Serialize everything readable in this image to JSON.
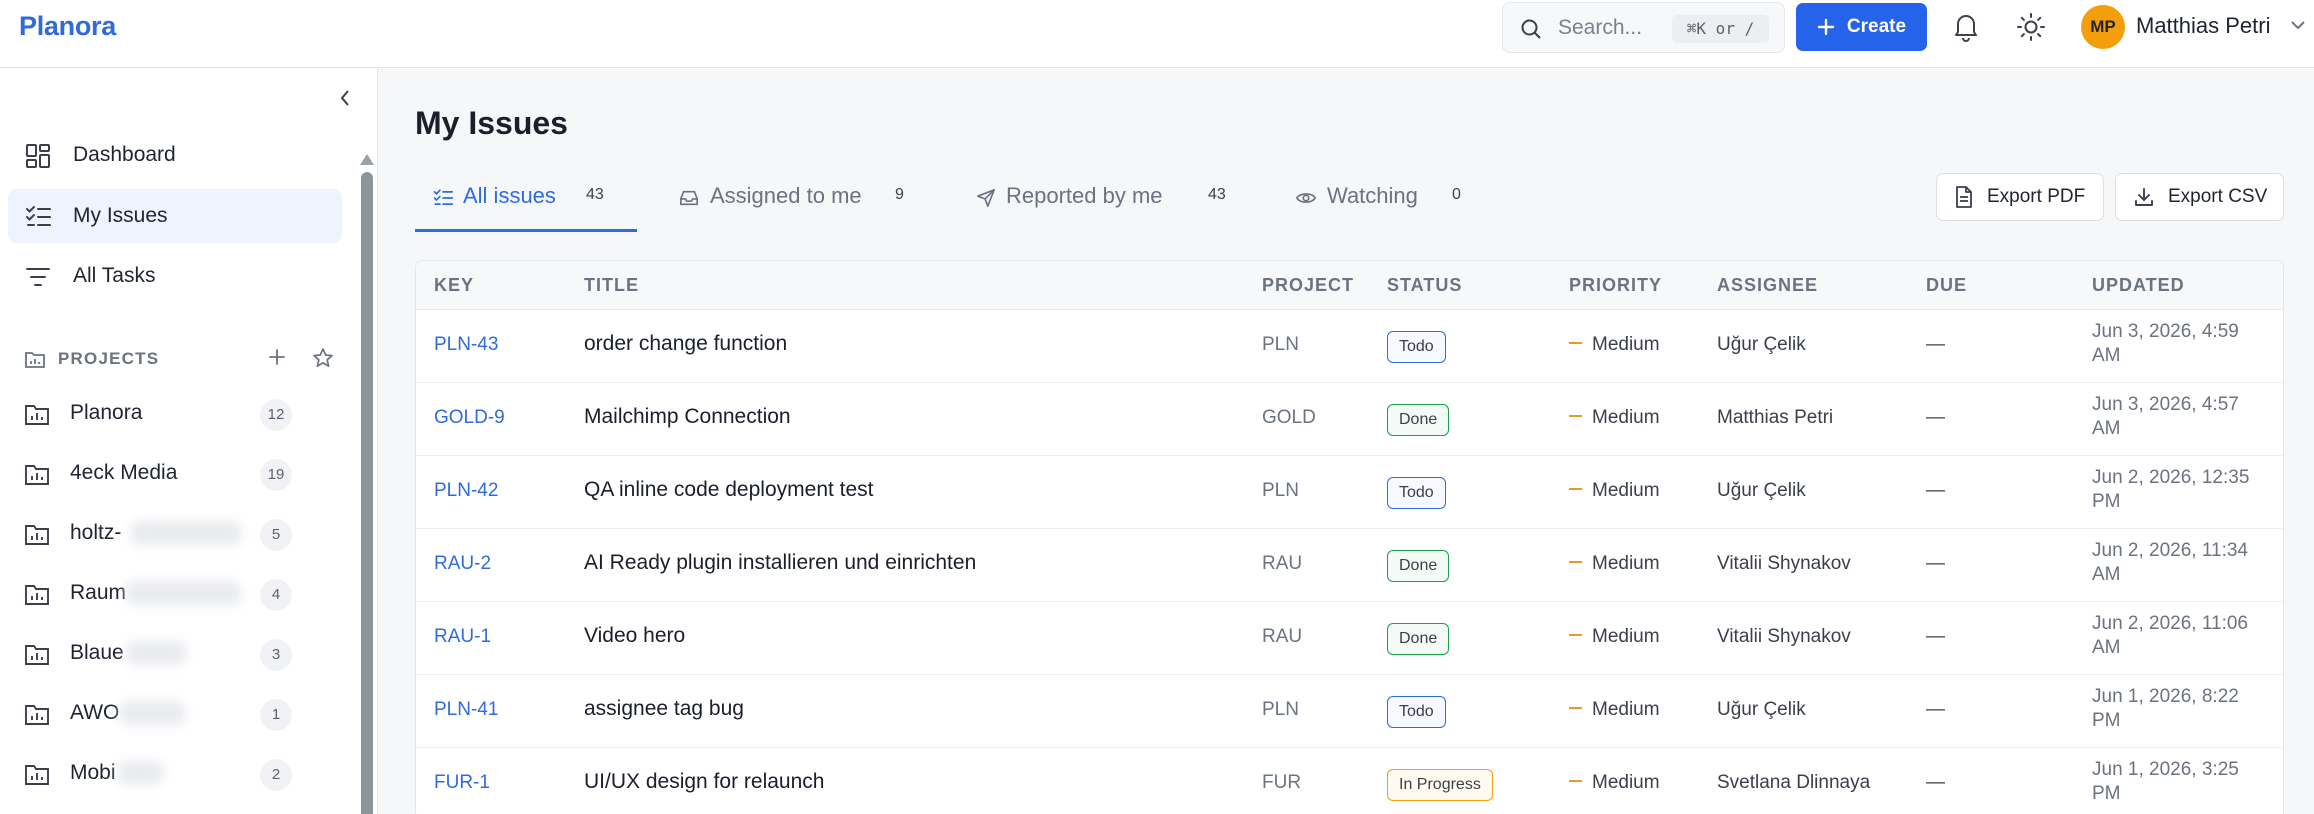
{
  "app": {
    "brand": "Planora"
  },
  "topbar": {
    "search_placeholder": "Search...",
    "search_shortcut": "⌘K or /",
    "create_label": "Create",
    "user_initials": "MP",
    "user_name": "Matthias Petri",
    "accent_color": "#2563eb",
    "avatar_color": "#f59e0b"
  },
  "sidebar": {
    "nav": [
      {
        "label": "Dashboard",
        "icon": "dashboard-icon"
      },
      {
        "label": "My Issues",
        "icon": "checklist-icon",
        "active": true
      },
      {
        "label": "All Tasks",
        "icon": "filter-lines-icon"
      }
    ],
    "projects_heading": "PROJECTS",
    "projects": [
      {
        "name": "Planora",
        "count": "12"
      },
      {
        "name": "4eck Media",
        "count": "19"
      },
      {
        "name": "holtz-",
        "count": "5"
      },
      {
        "name": "Raum",
        "count": "4"
      },
      {
        "name": "Blaue",
        "count": "3"
      },
      {
        "name": "AWO",
        "count": "1"
      },
      {
        "name": "Mobi",
        "count": "2"
      }
    ]
  },
  "main": {
    "title": "My Issues",
    "tabs": [
      {
        "label": "All issues",
        "count": "43",
        "icon": "checklist-icon",
        "active": true
      },
      {
        "label": "Assigned to me",
        "count": "9",
        "icon": "inbox-icon"
      },
      {
        "label": "Reported by me",
        "count": "43",
        "icon": "send-icon"
      },
      {
        "label": "Watching",
        "count": "0",
        "icon": "eye-icon"
      }
    ],
    "export_pdf": "Export PDF",
    "export_csv": "Export CSV",
    "columns": [
      "KEY",
      "TITLE",
      "PROJECT",
      "STATUS",
      "PRIORITY",
      "ASSIGNEE",
      "DUE",
      "UPDATED"
    ],
    "rows": [
      {
        "key": "PLN-43",
        "title": "order change function",
        "project": "PLN",
        "status": "Todo",
        "priority": "Medium",
        "assignee": "Uğur Çelik",
        "due": "—",
        "updated": "Jun 3, 2026, 4:59 AM"
      },
      {
        "key": "GOLD-9",
        "title": "Mailchimp Connection",
        "project": "GOLD",
        "status": "Done",
        "priority": "Medium",
        "assignee": "Matthias Petri",
        "due": "—",
        "updated": "Jun 3, 2026, 4:57 AM"
      },
      {
        "key": "PLN-42",
        "title": "QA inline code deployment test",
        "project": "PLN",
        "status": "Todo",
        "priority": "Medium",
        "assignee": "Uğur Çelik",
        "due": "—",
        "updated": "Jun 2, 2026, 12:35 PM"
      },
      {
        "key": "RAU-2",
        "title": "AI Ready plugin installieren und einrichten",
        "project": "RAU",
        "status": "Done",
        "priority": "Medium",
        "assignee": "Vitalii Shynakov",
        "due": "—",
        "updated": "Jun 2, 2026, 11:34 AM"
      },
      {
        "key": "RAU-1",
        "title": "Video hero",
        "project": "RAU",
        "status": "Done",
        "priority": "Medium",
        "assignee": "Vitalii Shynakov",
        "due": "—",
        "updated": "Jun 2, 2026, 11:06 AM"
      },
      {
        "key": "PLN-41",
        "title": "assignee tag bug",
        "project": "PLN",
        "status": "Todo",
        "priority": "Medium",
        "assignee": "Uğur Çelik",
        "due": "—",
        "updated": "Jun 1, 2026, 8:22 PM"
      },
      {
        "key": "FUR-1",
        "title": "UI/UX design for relaunch",
        "project": "FUR",
        "status": "In Progress",
        "priority": "Medium",
        "assignee": "Svetlana Dlinnaya",
        "due": "—",
        "updated": "Jun 1, 2026, 3:25 PM"
      }
    ]
  }
}
